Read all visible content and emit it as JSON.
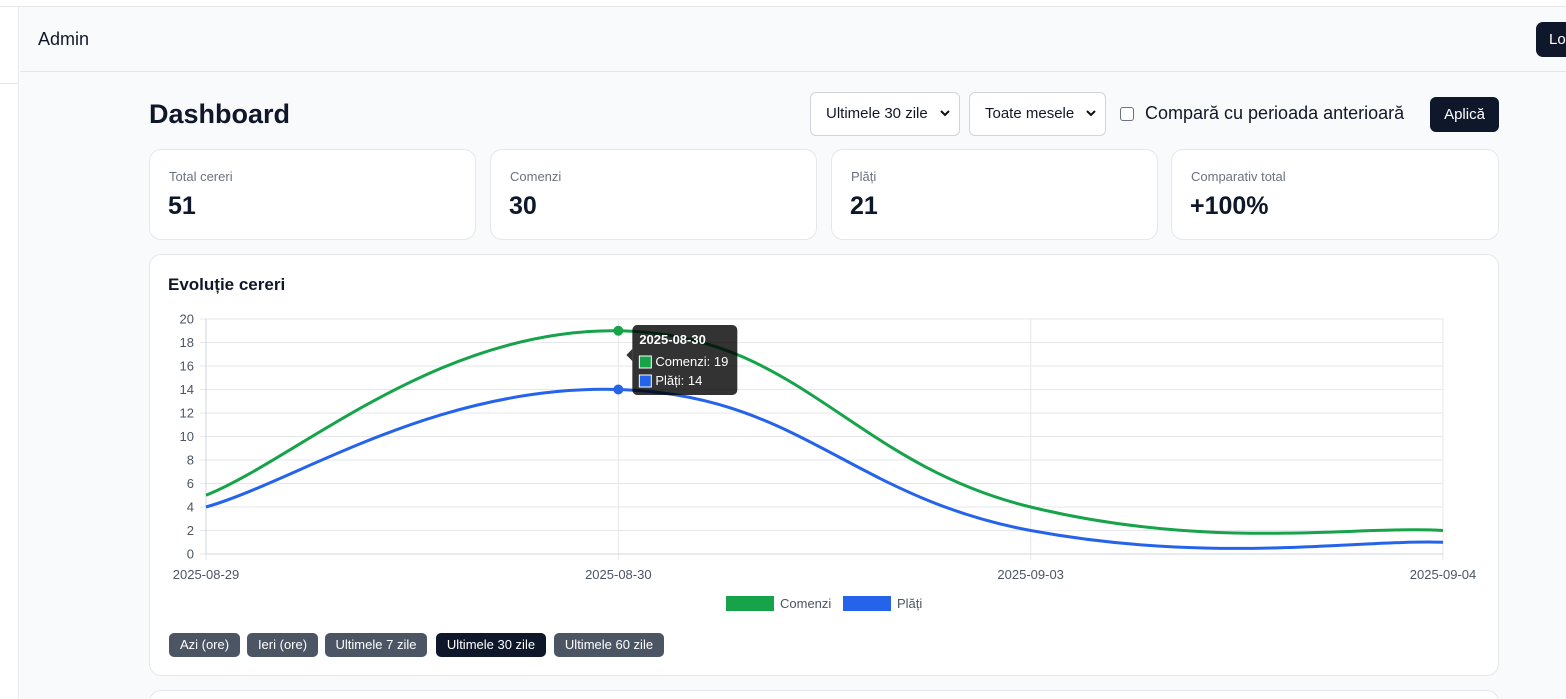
{
  "header": {
    "title": "Admin",
    "logout_label": "Logout"
  },
  "toolbar": {
    "page_title": "Dashboard",
    "period_select": "Ultimele 30 zile",
    "tables_select": "Toate mesele",
    "compare_label": "Compară cu perioada anterioară",
    "compare_checked": false,
    "apply_label": "Aplică"
  },
  "cards": [
    {
      "label": "Total cereri",
      "value": "51"
    },
    {
      "label": "Comenzi",
      "value": "30"
    },
    {
      "label": "Plăți",
      "value": "21"
    },
    {
      "label": "Comparativ total",
      "value": "+100%"
    }
  ],
  "chart_title": "Evoluție cereri",
  "chart_data": {
    "type": "line",
    "x": [
      "2025-08-29",
      "2025-08-30",
      "2025-09-03",
      "2025-09-04"
    ],
    "ylim": [
      0,
      20
    ],
    "yticks": [
      0,
      2,
      4,
      6,
      8,
      10,
      12,
      14,
      16,
      18,
      20
    ],
    "grid": true,
    "legend_position": "bottom",
    "series": [
      {
        "name": "Comenzi",
        "color": "#16a34a",
        "values": [
          5,
          19,
          4,
          2
        ]
      },
      {
        "name": "Plăți",
        "color": "#2563eb",
        "values": [
          4,
          14,
          2,
          1
        ]
      }
    ],
    "tooltip": {
      "title": "2025-08-30",
      "items": [
        "Comenzi: 19",
        "Plăți: 14"
      ]
    }
  },
  "range_buttons": [
    {
      "label": "Azi (ore)",
      "active": false
    },
    {
      "label": "Ieri (ore)",
      "active": false
    },
    {
      "label": "Ultimele 7 zile",
      "active": false
    },
    {
      "label": "Ultimele 30 zile",
      "active": true
    },
    {
      "label": "Ultimele 60 zile",
      "active": false
    }
  ]
}
